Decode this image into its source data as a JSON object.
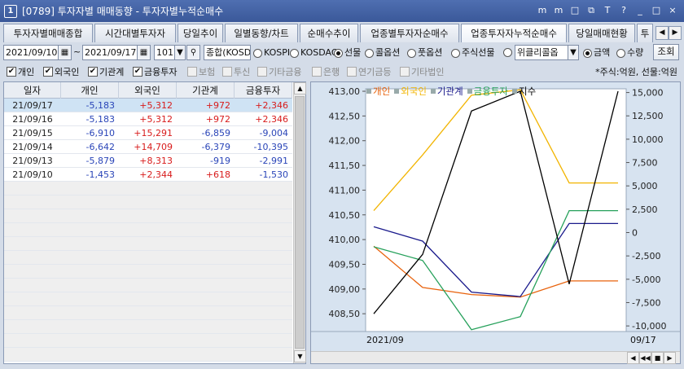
{
  "window": {
    "number": "1",
    "title": "[0789] 투자자별 매매동향 - 투자자별누적순매수",
    "ctrls": [
      "m",
      "m",
      "□",
      "⧉",
      "T",
      "?",
      "_",
      "□",
      "×"
    ]
  },
  "tabs": [
    "투자자별매매종합",
    "시간대별투자자",
    "당일추이",
    "일별동향/차트",
    "순매수추이",
    "업종별투자자순매수",
    "업종투자자누적순매수",
    "당일매매현황",
    "투"
  ],
  "controls": {
    "date_from": "2021/09/10",
    "date_sep": "~",
    "date_to": "2021/09/17",
    "code": "101",
    "market": "종합(KOSD",
    "markets": [
      {
        "label": "KOSPI",
        "on": false
      },
      {
        "label": "KOSDAQ",
        "on": false
      },
      {
        "label": "선물",
        "on": true
      },
      {
        "label": "콜옵션",
        "on": false
      },
      {
        "label": "풋옵션",
        "on": false
      },
      {
        "label": "주식선물",
        "on": false
      }
    ],
    "weekly": "위클리콜옵",
    "units": [
      {
        "label": "금액",
        "on": true
      },
      {
        "label": "수량",
        "on": false
      }
    ],
    "query_button": "조회"
  },
  "filters": [
    {
      "label": "개인",
      "on": true
    },
    {
      "label": "외국인",
      "on": true
    },
    {
      "label": "기관계",
      "on": true
    },
    {
      "label": "금융투자",
      "on": true
    },
    {
      "label": "보험",
      "on": false
    },
    {
      "label": "투신",
      "on": false
    },
    {
      "label": "기타금융",
      "on": false
    },
    {
      "label": "은행",
      "on": false
    },
    {
      "label": "연기금등",
      "on": false
    },
    {
      "label": "기타법인",
      "on": false
    }
  ],
  "unit_note": "*주식:억원, 선물:억원",
  "table": {
    "headers": [
      "일자",
      "개인",
      "외국인",
      "기관계",
      "금융투자"
    ],
    "rows": [
      [
        "21/09/17",
        "-5,183",
        "+5,312",
        "+972",
        "+2,346"
      ],
      [
        "21/09/16",
        "-5,183",
        "+5,312",
        "+972",
        "+2,346"
      ],
      [
        "21/09/15",
        "-6,910",
        "+15,291",
        "-6,859",
        "-9,004"
      ],
      [
        "21/09/14",
        "-6,642",
        "+14,709",
        "-6,379",
        "-10,395"
      ],
      [
        "21/09/13",
        "-5,879",
        "+8,313",
        "-919",
        "-2,991"
      ],
      [
        "21/09/10",
        "-1,453",
        "+2,344",
        "+618",
        "-1,530"
      ]
    ]
  },
  "chart_data": {
    "type": "line",
    "x": [
      "21/09/10",
      "21/09/13",
      "21/09/14",
      "21/09/15",
      "21/09/16",
      "21/09/17"
    ],
    "series": [
      {
        "name": "개인",
        "color": "#e8620c",
        "axis": "right",
        "values": [
          -1453,
          -5879,
          -6642,
          -6910,
          -5183,
          -5183
        ]
      },
      {
        "name": "외국인",
        "color": "#f2b400",
        "axis": "right",
        "values": [
          2344,
          8313,
          14709,
          15291,
          5312,
          5312
        ]
      },
      {
        "name": "기관계",
        "color": "#1a1a8c",
        "axis": "right",
        "values": [
          618,
          -919,
          -6379,
          -6859,
          972,
          972
        ]
      },
      {
        "name": "금융투자",
        "color": "#25a05a",
        "axis": "right",
        "values": [
          -1530,
          -2991,
          -10395,
          -9004,
          2346,
          2346
        ]
      },
      {
        "name": "지수",
        "color": "#000000",
        "axis": "left",
        "values": [
          408.5,
          409.7,
          412.6,
          413.0,
          409.1,
          413.0
        ]
      }
    ],
    "y_left": {
      "ticks": [
        "413,00",
        "412,50",
        "412,00",
        "411,50",
        "411,00",
        "410,50",
        "410,00",
        "409,50",
        "409,00",
        "408,50"
      ],
      "range": [
        408.14,
        413.05
      ]
    },
    "y_right": {
      "ticks": [
        "15,000",
        "12,500",
        "10,000",
        "7,500",
        "5,000",
        "2,500",
        "0",
        "-2,500",
        "-5,000",
        "-7,500",
        "-10,000"
      ],
      "range": [
        -10600,
        15400
      ]
    },
    "x_start_label": "2021/09",
    "x_end_label": "09/17",
    "grid": false,
    "legend": "top-left"
  }
}
